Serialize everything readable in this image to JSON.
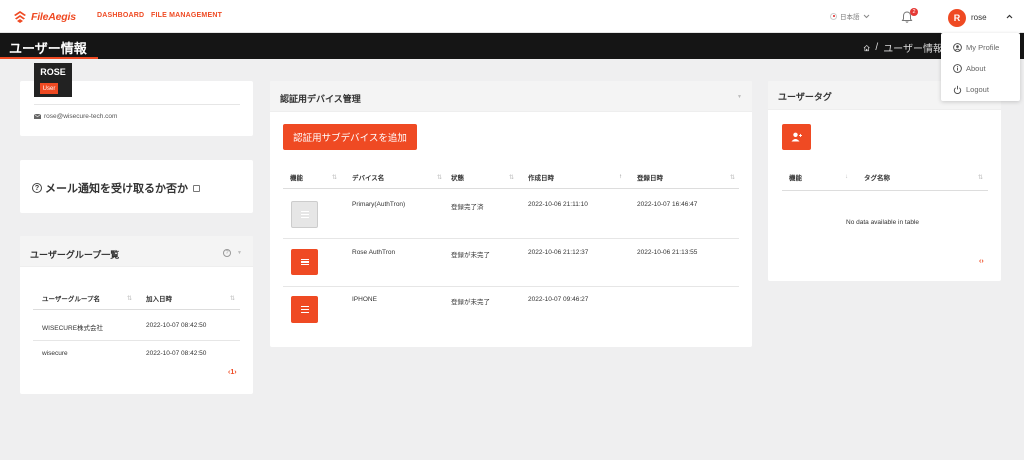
{
  "brand": {
    "name": "FileAegis",
    "color": "#ef4a23"
  },
  "nav": {
    "dashboard": "DASHBOARD",
    "file_management": "FILE MANAGEMENT"
  },
  "lang": {
    "label": "日本語"
  },
  "notifications": {
    "count": "2"
  },
  "user": {
    "initial": "R",
    "name": "rose"
  },
  "dropdown": {
    "items": [
      "My Profile",
      "About",
      "Logout"
    ]
  },
  "page": {
    "title": "ユーザー情報",
    "breadcrumb": "ユーザー情報"
  },
  "profile": {
    "name": "ROSE",
    "role": "User",
    "email": "rose@wisecure-tech.com"
  },
  "mail": {
    "label": "メール通知を受け取るか否か"
  },
  "groups": {
    "title": "ユーザーグループ一覧",
    "columns": [
      "ユーザーグループ名",
      "加入日時"
    ],
    "rows": [
      {
        "name": "WISECURE株式会社",
        "joined": "2022-10-07 08:42:50"
      },
      {
        "name": "wisecure",
        "joined": "2022-10-07 08:42:50"
      }
    ],
    "pager": "‹1›"
  },
  "devices": {
    "title": "認証用デバイス管理",
    "add_button": "認証用サブデバイスを追加",
    "columns": [
      "機能",
      "デバイス名",
      "状態",
      "作成日時",
      "登録日時"
    ],
    "rows": [
      {
        "name": "Primary(AuthTron)",
        "status": "登録完了済",
        "created": "2022-10-06 21:11:10",
        "registered": "2022-10-07 16:46:47"
      },
      {
        "name": "Rose AuthTron",
        "status": "登録が未完了",
        "created": "2022-10-06 21:12:37",
        "registered": "2022-10-06 21:13:55"
      },
      {
        "name": "IPHONE",
        "status": "登録が未完了",
        "created": "2022-10-07 09:46:27",
        "registered": ""
      }
    ]
  },
  "tags": {
    "title": "ユーザータグ",
    "columns": [
      "機能",
      "タグ名称"
    ],
    "empty": "No data available in table",
    "pager": "‹›"
  }
}
